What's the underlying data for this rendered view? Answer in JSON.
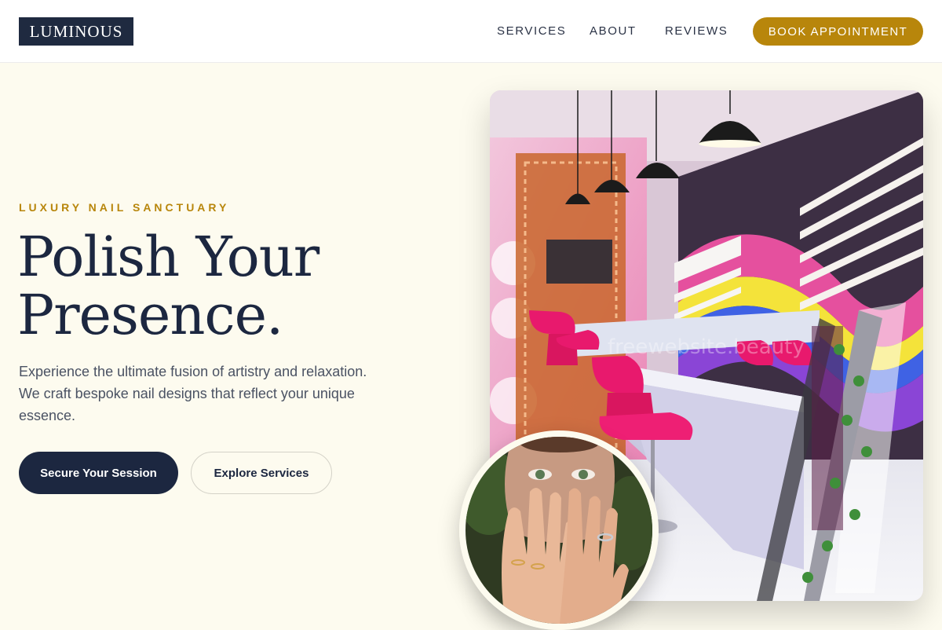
{
  "nav": {
    "logo": "LUMINOUS",
    "links": [
      "SERVICES",
      "ABOUT",
      "REVIEWS"
    ],
    "cta": "BOOK APPOINTMENT"
  },
  "hero": {
    "eyebrow": "LUXURY NAIL SANCTUARY",
    "headline_line1": "Polish Your",
    "headline_line2": "Presence.",
    "subtext": "Experience the ultimate fusion of artistry and relaxation. We craft bespoke nail designs that reflect your unique essence.",
    "primary_button": "Secure Your Session",
    "secondary_button": "Explore Services"
  },
  "images": {
    "salon_photo_watermark": "freewebsite.beauty"
  },
  "colors": {
    "accent_gold": "#b8860b",
    "navy": "#1c2740",
    "background_cream": "#fdfbef"
  }
}
